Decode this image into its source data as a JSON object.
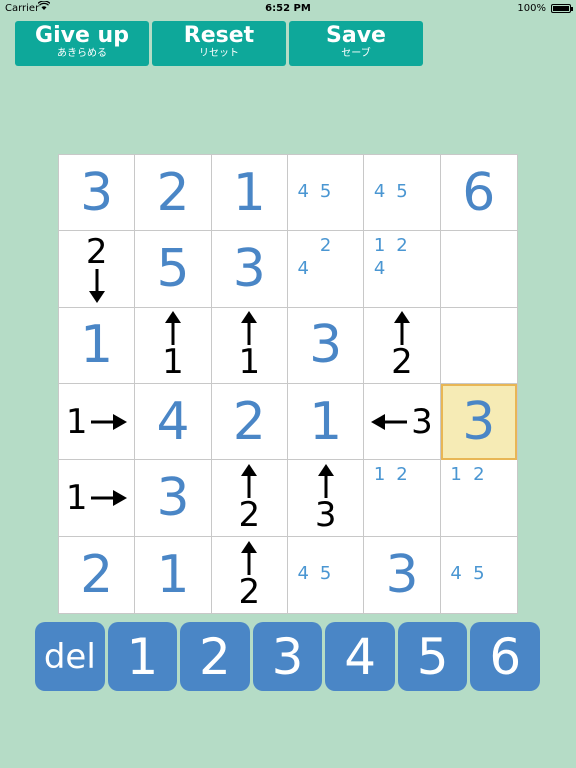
{
  "status": {
    "carrier": "Carrier",
    "time": "6:52 PM",
    "battery": "100%"
  },
  "toolbar": {
    "giveup": {
      "label": "Give up",
      "sub": "あきらめる"
    },
    "reset": {
      "label": "Reset",
      "sub": "リセット"
    },
    "save": {
      "label": "Save",
      "sub": "セーブ"
    }
  },
  "board": {
    "rows": [
      [
        {
          "type": "value",
          "value": "3"
        },
        {
          "type": "value",
          "value": "2"
        },
        {
          "type": "value",
          "value": "1"
        },
        {
          "type": "notes",
          "notes": [
            "",
            "",
            "",
            "4",
            "5",
            "",
            "",
            "",
            ""
          ]
        },
        {
          "type": "notes",
          "notes": [
            "",
            "",
            "",
            "4",
            "5",
            "",
            "",
            "",
            ""
          ]
        },
        {
          "type": "value",
          "value": "6"
        }
      ],
      [
        {
          "type": "clue",
          "dir": "down",
          "value": "2"
        },
        {
          "type": "value",
          "value": "5"
        },
        {
          "type": "value",
          "value": "3"
        },
        {
          "type": "notes",
          "notes": [
            "",
            "2",
            "",
            "4",
            "",
            "",
            "",
            "",
            ""
          ]
        },
        {
          "type": "notes",
          "notes": [
            "1",
            "2",
            "",
            "4",
            "",
            "",
            "",
            "",
            ""
          ]
        },
        {
          "type": "empty"
        }
      ],
      [
        {
          "type": "value",
          "value": "1"
        },
        {
          "type": "clue",
          "dir": "up",
          "value": "1"
        },
        {
          "type": "clue",
          "dir": "up",
          "value": "1"
        },
        {
          "type": "value",
          "value": "3"
        },
        {
          "type": "clue",
          "dir": "up",
          "value": "2"
        },
        {
          "type": "empty"
        }
      ],
      [
        {
          "type": "clue",
          "dir": "right",
          "value": "1"
        },
        {
          "type": "value",
          "value": "4"
        },
        {
          "type": "value",
          "value": "2"
        },
        {
          "type": "value",
          "value": "1"
        },
        {
          "type": "clue",
          "dir": "left",
          "value": "3"
        },
        {
          "type": "value",
          "value": "3",
          "selected": true
        }
      ],
      [
        {
          "type": "clue",
          "dir": "right",
          "value": "1"
        },
        {
          "type": "value",
          "value": "3"
        },
        {
          "type": "clue",
          "dir": "up",
          "value": "2"
        },
        {
          "type": "clue",
          "dir": "up",
          "value": "3"
        },
        {
          "type": "notes",
          "notes": [
            "1",
            "2",
            "",
            "",
            "",
            "",
            "",
            "",
            ""
          ]
        },
        {
          "type": "notes",
          "notes": [
            "1",
            "2",
            "",
            "",
            "",
            "",
            "",
            "",
            ""
          ]
        }
      ],
      [
        {
          "type": "value",
          "value": "2"
        },
        {
          "type": "value",
          "value": "1"
        },
        {
          "type": "clue",
          "dir": "up",
          "value": "2"
        },
        {
          "type": "notes",
          "notes": [
            "",
            "",
            "",
            "4",
            "5",
            "",
            "",
            "",
            ""
          ]
        },
        {
          "type": "value",
          "value": "3"
        },
        {
          "type": "notes",
          "notes": [
            "",
            "",
            "",
            "4",
            "5",
            "",
            "",
            "",
            ""
          ]
        }
      ]
    ]
  },
  "numpad": {
    "keys": [
      "del",
      "1",
      "2",
      "3",
      "4",
      "5",
      "6"
    ]
  },
  "colors": {
    "background": "#b5dcc6",
    "toolbar_button": "#0ea89a",
    "numpad_button": "#4a86c6",
    "cell_value": "#4a86c6",
    "selected_cell": "#f6ebb5"
  }
}
